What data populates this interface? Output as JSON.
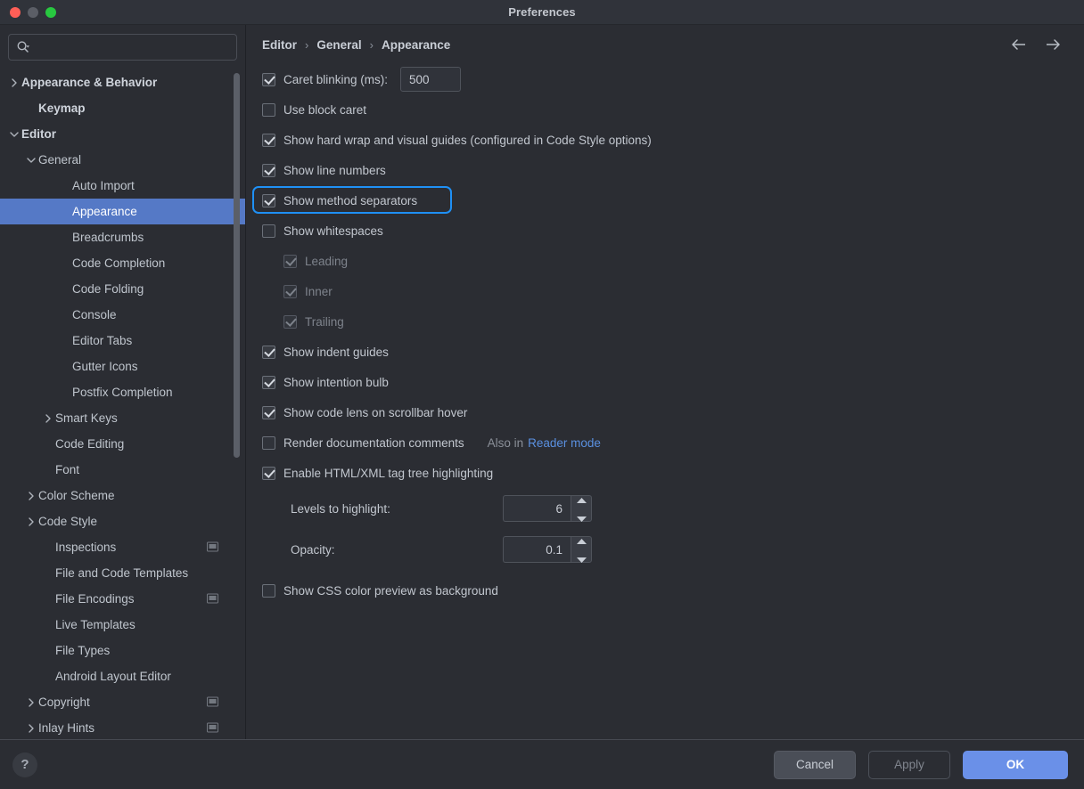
{
  "window": {
    "title": "Preferences",
    "traffic_lights": [
      "close-button",
      "minimize-button",
      "zoom-button"
    ]
  },
  "colors": {
    "accent_blue": "#6a90e8",
    "focus_ring": "#1f90f5",
    "selection": "#5579c6",
    "link": "#5a90e0",
    "background": "#2b2d33"
  },
  "search": {
    "placeholder": "",
    "value": "",
    "icon": "search-icon"
  },
  "sidebar": {
    "items": [
      {
        "label": "Appearance & Behavior",
        "indent": 0,
        "chevron": "right",
        "bold": true,
        "selected": false,
        "badge": false
      },
      {
        "label": "Keymap",
        "indent": 1,
        "chevron": "none",
        "bold": true,
        "selected": false,
        "badge": false
      },
      {
        "label": "Editor",
        "indent": 0,
        "chevron": "down",
        "bold": true,
        "selected": false,
        "badge": false
      },
      {
        "label": "General",
        "indent": 1,
        "chevron": "down",
        "bold": false,
        "selected": false,
        "badge": false
      },
      {
        "label": "Auto Import",
        "indent": 3,
        "chevron": "none",
        "bold": false,
        "selected": false,
        "badge": false
      },
      {
        "label": "Appearance",
        "indent": 3,
        "chevron": "none",
        "bold": false,
        "selected": true,
        "badge": false
      },
      {
        "label": "Breadcrumbs",
        "indent": 3,
        "chevron": "none",
        "bold": false,
        "selected": false,
        "badge": false
      },
      {
        "label": "Code Completion",
        "indent": 3,
        "chevron": "none",
        "bold": false,
        "selected": false,
        "badge": false
      },
      {
        "label": "Code Folding",
        "indent": 3,
        "chevron": "none",
        "bold": false,
        "selected": false,
        "badge": false
      },
      {
        "label": "Console",
        "indent": 3,
        "chevron": "none",
        "bold": false,
        "selected": false,
        "badge": false
      },
      {
        "label": "Editor Tabs",
        "indent": 3,
        "chevron": "none",
        "bold": false,
        "selected": false,
        "badge": false
      },
      {
        "label": "Gutter Icons",
        "indent": 3,
        "chevron": "none",
        "bold": false,
        "selected": false,
        "badge": false
      },
      {
        "label": "Postfix Completion",
        "indent": 3,
        "chevron": "none",
        "bold": false,
        "selected": false,
        "badge": false
      },
      {
        "label": "Smart Keys",
        "indent": 2,
        "chevron": "right",
        "bold": false,
        "selected": false,
        "badge": false
      },
      {
        "label": "Code Editing",
        "indent": 2,
        "chevron": "none",
        "bold": false,
        "selected": false,
        "badge": false
      },
      {
        "label": "Font",
        "indent": 2,
        "chevron": "none",
        "bold": false,
        "selected": false,
        "badge": false
      },
      {
        "label": "Color Scheme",
        "indent": 1,
        "chevron": "right",
        "bold": false,
        "selected": false,
        "badge": false
      },
      {
        "label": "Code Style",
        "indent": 1,
        "chevron": "right",
        "bold": false,
        "selected": false,
        "badge": false
      },
      {
        "label": "Inspections",
        "indent": 2,
        "chevron": "none",
        "bold": false,
        "selected": false,
        "badge": true
      },
      {
        "label": "File and Code Templates",
        "indent": 2,
        "chevron": "none",
        "bold": false,
        "selected": false,
        "badge": false
      },
      {
        "label": "File Encodings",
        "indent": 2,
        "chevron": "none",
        "bold": false,
        "selected": false,
        "badge": true
      },
      {
        "label": "Live Templates",
        "indent": 2,
        "chevron": "none",
        "bold": false,
        "selected": false,
        "badge": false
      },
      {
        "label": "File Types",
        "indent": 2,
        "chevron": "none",
        "bold": false,
        "selected": false,
        "badge": false
      },
      {
        "label": "Android Layout Editor",
        "indent": 2,
        "chevron": "none",
        "bold": false,
        "selected": false,
        "badge": false
      },
      {
        "label": "Copyright",
        "indent": 1,
        "chevron": "right",
        "bold": false,
        "selected": false,
        "badge": true
      },
      {
        "label": "Inlay Hints",
        "indent": 1,
        "chevron": "right",
        "bold": false,
        "selected": false,
        "badge": true
      }
    ]
  },
  "breadcrumb": {
    "items": [
      "Editor",
      "General",
      "Appearance"
    ],
    "separator": "›"
  },
  "nav": {
    "back": "back-arrow",
    "forward": "forward-arrow"
  },
  "settings": {
    "caret_blinking": {
      "label": "Caret blinking (ms):",
      "checked": true,
      "value": "500"
    },
    "use_block_caret": {
      "label": "Use block caret",
      "checked": false
    },
    "show_hard_wrap": {
      "label": "Show hard wrap and visual guides (configured in Code Style options)",
      "checked": true
    },
    "show_line_numbers": {
      "label": "Show line numbers",
      "checked": true
    },
    "show_method_separators": {
      "label": "Show method separators",
      "checked": true,
      "focused": true
    },
    "show_whitespaces": {
      "label": "Show whitespaces",
      "checked": false
    },
    "whitespace_leading": {
      "label": "Leading",
      "checked": true,
      "disabled": true
    },
    "whitespace_inner": {
      "label": "Inner",
      "checked": true,
      "disabled": true
    },
    "whitespace_trailing": {
      "label": "Trailing",
      "checked": true,
      "disabled": true
    },
    "show_indent_guides": {
      "label": "Show indent guides",
      "checked": true
    },
    "show_intention_bulb": {
      "label": "Show intention bulb",
      "checked": true
    },
    "show_code_lens": {
      "label": "Show code lens on scrollbar hover",
      "checked": true
    },
    "render_doc_comments": {
      "label": "Render documentation comments",
      "checked": false,
      "also_in": "Also in",
      "link": "Reader mode"
    },
    "enable_tag_tree": {
      "label": "Enable HTML/XML tag tree highlighting",
      "checked": true
    },
    "levels_to_highlight": {
      "label": "Levels to highlight:",
      "value": "6"
    },
    "opacity": {
      "label": "Opacity:",
      "value": "0.1"
    },
    "show_css_preview": {
      "label": "Show CSS color preview as background",
      "checked": false
    }
  },
  "footer": {
    "help": "?",
    "cancel": "Cancel",
    "apply": "Apply",
    "ok": "OK"
  }
}
